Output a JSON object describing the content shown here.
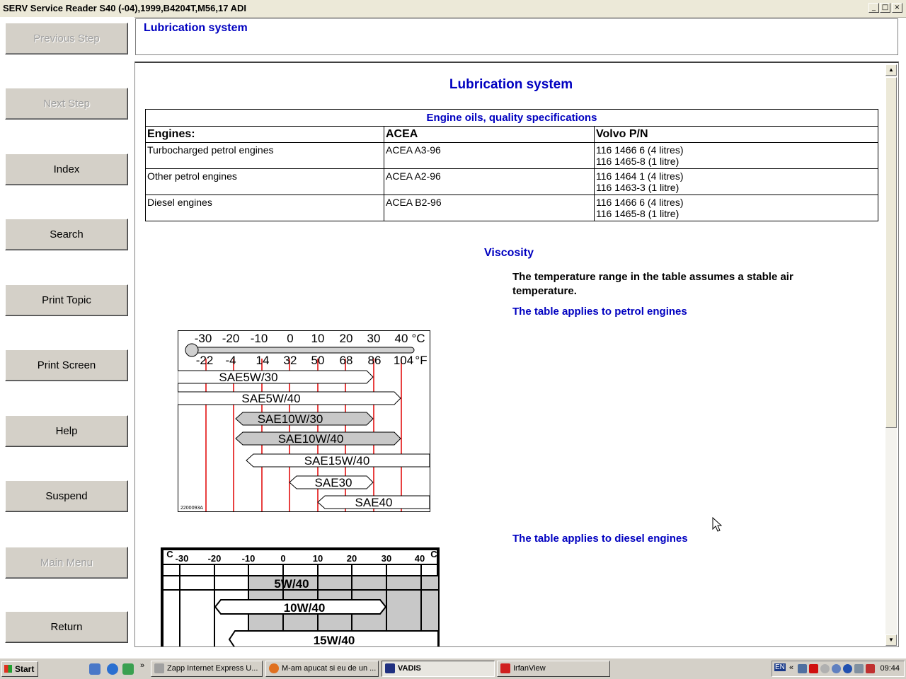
{
  "window": {
    "title": "SERV Service Reader S40 (-04),1999,B4204T,M56,17 ADI"
  },
  "nav": {
    "previous": "Previous Step",
    "next": "Next Step",
    "index": "Index",
    "search": "Search",
    "print_topic": "Print Topic",
    "print_screen": "Print Screen",
    "help": "Help",
    "suspend": "Suspend",
    "main_menu": "Main Menu",
    "return": "Return"
  },
  "topic": {
    "header": "Lubrication system"
  },
  "content": {
    "title": "Lubrication system",
    "table": {
      "caption": "Engine oils, quality specifications",
      "headers": [
        "Engines:",
        "ACEA",
        "Volvo P/N"
      ],
      "rows": [
        {
          "engine": "Turbocharged petrol engines",
          "acea": "ACEA A3-96",
          "pn1": "116 1466 6 (4 litres)",
          "pn2": "116 1465-8 (1 litre)"
        },
        {
          "engine": "Other petrol engines",
          "acea": "ACEA A2-96",
          "pn1": "116 1464 1 (4 litres)",
          "pn2": "116 1463-3 (1 litre)"
        },
        {
          "engine": "Diesel engines",
          "acea": "ACEA B2-96",
          "pn1": "116 1466 6 (4 litres)",
          "pn2": "116 1465-8 (1 litre)"
        }
      ]
    },
    "viscosity_heading": "Viscosity",
    "note": "The temperature range in the table assumes a stable air temperature.",
    "petrol_note": "The table applies to petrol engines",
    "diesel_note": "The table applies to diesel engines",
    "petrol_chart": {
      "celsius": [
        "-30",
        "-20",
        "-10",
        "0",
        "10",
        "20",
        "30",
        "40"
      ],
      "fahrenheit": [
        "-22",
        "-4",
        "14",
        "32",
        "50",
        "68",
        "86",
        "104"
      ],
      "c_unit": "°C",
      "f_unit": "°F",
      "code": "2200093A",
      "grades": [
        "SAE5W/30",
        "SAE5W/40",
        "SAE10W/30",
        "SAE10W/40",
        "SAE15W/40",
        "SAE30",
        "SAE40"
      ]
    },
    "diesel_chart": {
      "celsius": [
        "-30",
        "-20",
        "-10",
        "0",
        "10",
        "20",
        "30",
        "40"
      ],
      "unit": "C",
      "grades": [
        "5W/40",
        "10W/40",
        "15W/40"
      ]
    }
  },
  "taskbar": {
    "start": "Start",
    "tasks": [
      "Zapp Internet Express U...",
      "M-am apucat si eu de un ...",
      "VADIS",
      "IrfanView"
    ],
    "lang": "EN",
    "clock": "09:44"
  }
}
